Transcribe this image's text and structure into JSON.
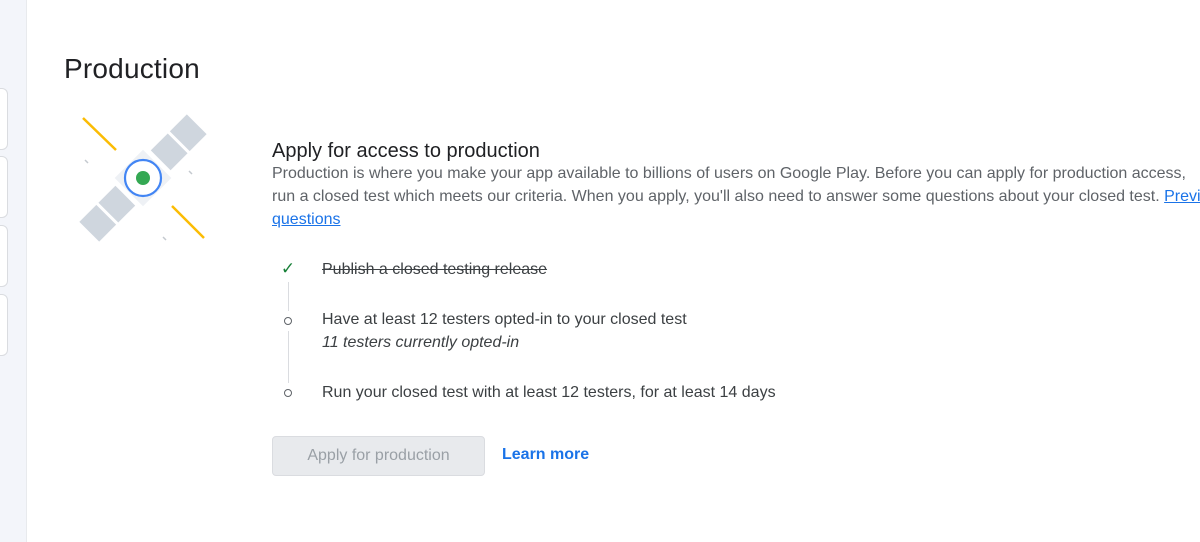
{
  "page": {
    "title": "Production"
  },
  "illustration": {
    "icon": "satellite-illustration",
    "colors": {
      "panel": "#cfd6de",
      "ring": "#4285f4",
      "core": "#34a853",
      "beam": "#fbbc04"
    }
  },
  "main": {
    "heading": "Apply for access to production",
    "description": {
      "line1": "Production is where you make your app available to billions of users on Google Play. Before you can apply for production access,",
      "line2_text": "run a closed test which meets our criteria. When you apply, you'll also need to answer some questions about your closed test. ",
      "line2_link_start": "Preview",
      "line3_link_end": "questions"
    },
    "steps": [
      {
        "label": "Publish a closed testing release",
        "status": "done",
        "marker_icon": "check-icon"
      },
      {
        "label": "Have at least 12 testers opted-in to your closed test",
        "sublabel": "11 testers currently opted-in",
        "status": "pending",
        "marker_icon": "circle-outline-icon"
      },
      {
        "label": "Run your closed test with at least 12 testers, for at least 14 days",
        "status": "pending",
        "marker_icon": "circle-outline-icon"
      }
    ],
    "actions": {
      "apply_label": "Apply for production",
      "apply_disabled": true,
      "learn_more_label": "Learn more"
    }
  },
  "colors": {
    "accent": "#1a73e8",
    "success": "#188038",
    "text": "#202124",
    "muted": "#5f6368",
    "disabled_bg": "#e8eaed"
  }
}
